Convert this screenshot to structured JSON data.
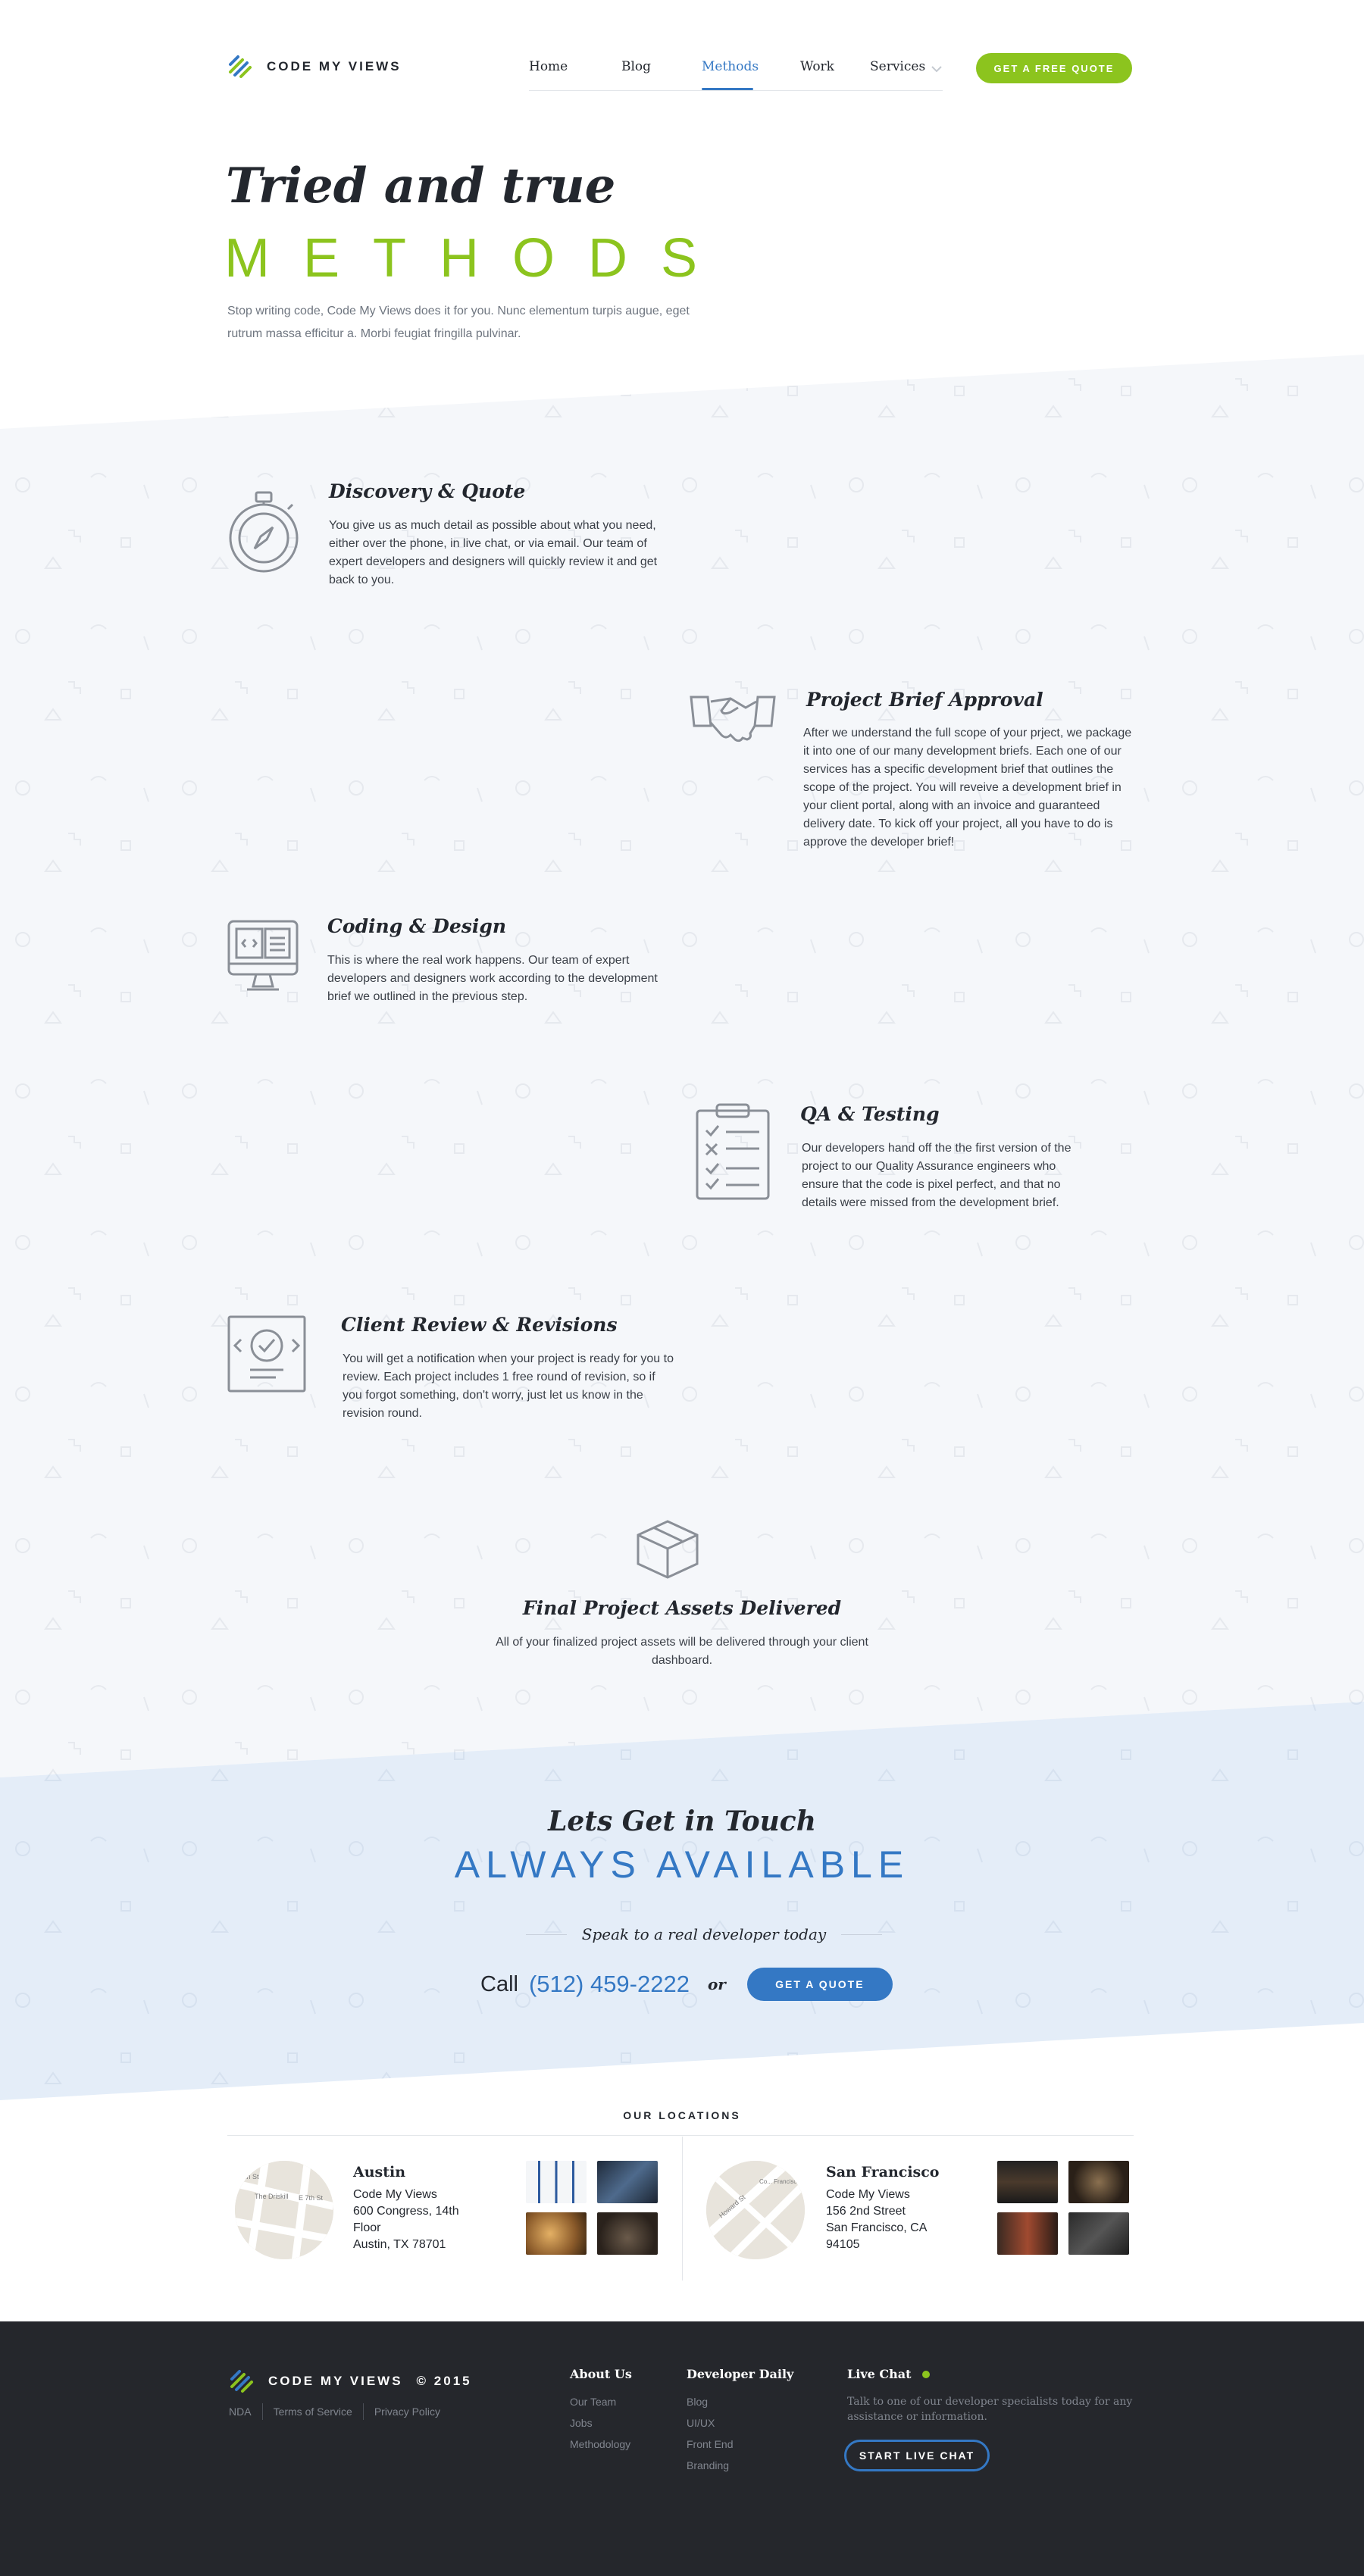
{
  "brand": {
    "name": "CODE MY VIEWS",
    "year": "© 2015"
  },
  "nav": {
    "items": [
      "Home",
      "Blog",
      "Methods",
      "Work",
      "Services"
    ],
    "active": "Methods",
    "cta": "GET A FREE QUOTE"
  },
  "hero": {
    "title": "Tried and true",
    "subtitle": "METHODS",
    "description": "Stop writing code, Code My Views does it for you. Nunc elementum turpis augue, eget rutrum massa efficitur a. Morbi feugiat fringilla pulvinar."
  },
  "steps": [
    {
      "icon": "stopwatch-icon",
      "title": "Discovery & Quote",
      "body": "You give us as much detail as possible about what you need, either over the phone, in live chat, or via email. Our team of expert developers and designers will quickly review it and get back to you."
    },
    {
      "icon": "handshake-icon",
      "title": "Project Brief Approval",
      "body": "After we understand the full scope of your prject, we package it into one of our many development briefs. Each one of our services has a specific development brief that outlines the scope of the project. You will reveive a development brief in your client portal, along with an invoice and guaranteed delivery date. To kick off your project, all you have to do is approve the developer brief!"
    },
    {
      "icon": "monitor-code-icon",
      "title": "Coding & Design",
      "body": "This is where the real work happens. Our team of expert developers and designers work according to the development brief we outlined in the previous step."
    },
    {
      "icon": "clipboard-checklist-icon",
      "title": "QA & Testing",
      "body": "Our developers hand off the the first version of the project to our Quality Assurance engineers who ensure that the code is pixel perfect, and that no details were missed from the development brief."
    },
    {
      "icon": "review-check-icon",
      "title": "Client Review & Revisions",
      "body": "You will get a notification when your project is ready for you to review. Each project includes 1 free round of revision, so if you forgot something, don't worry, just let us know in the revision round."
    },
    {
      "icon": "package-box-icon",
      "title": "Final Project Assets Delivered",
      "body": "All of your finalized project assets will be delivered through your client dashboard."
    }
  ],
  "contact": {
    "title": "Lets Get in Touch",
    "subtitle": "ALWAYS AVAILABLE",
    "speak": "Speak to a real developer today",
    "call_label": "Call",
    "phone": "(512) 459-2222",
    "or": "or",
    "cta": "GET A QUOTE"
  },
  "locations": {
    "heading": "OUR LOCATIONS",
    "items": [
      {
        "city": "Austin",
        "lines": [
          "Code My Views",
          "600 Congress, 14th",
          "Floor",
          "Austin, TX 78701"
        ],
        "map_labels": [
          "E 7th St",
          "The Driskill",
          "6th St"
        ]
      },
      {
        "city": "San Francisco",
        "lines": [
          "Code My Views",
          "156 2nd Street",
          "San Francisco, CA",
          "94105"
        ],
        "map_labels": [
          "Howard St",
          "Co... Francisco D..."
        ]
      }
    ]
  },
  "footer": {
    "legal": [
      "NDA",
      "Terms of Service",
      "Privacy Policy"
    ],
    "about": {
      "title": "About Us",
      "links": [
        "Our Team",
        "Jobs",
        "Methodology"
      ]
    },
    "daily": {
      "title": "Developer Daily",
      "links": [
        "Blog",
        "UI/UX",
        "Front End",
        "Branding"
      ]
    },
    "chat": {
      "title": "Live Chat",
      "desc": "Talk to one of our developer specialists today for any assistance or information.",
      "cta": "START LIVE CHAT"
    }
  },
  "colors": {
    "green": "#8cc41e",
    "blue": "#3478c4",
    "dark": "#25272c",
    "steps_bg": "#f5f7fa",
    "contact_bg": "#e4edf8"
  }
}
